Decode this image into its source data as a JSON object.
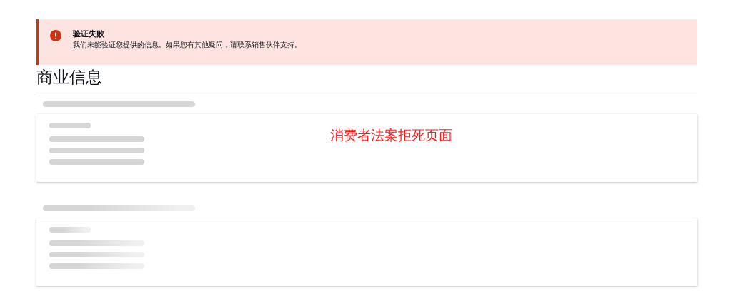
{
  "alert": {
    "title": "验证失败",
    "message": "我们未能验证您提供的信息。如果您有其他疑问，请联系销售伙伴支持。"
  },
  "heading": "商业信息",
  "sections": [
    {
      "shimmer": false,
      "note": "消费者法案拒死页面"
    },
    {
      "shimmer": true
    }
  ]
}
